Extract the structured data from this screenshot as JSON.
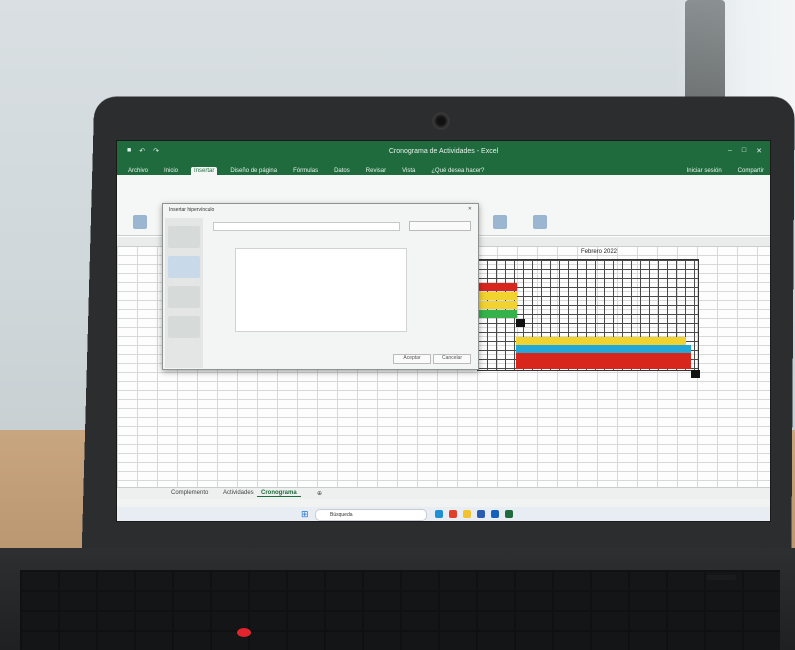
{
  "scene": "laptop-with-excel-gantt",
  "excel": {
    "title": "Cronograma de Actividades - Excel",
    "tabs": [
      "Archivo",
      "Inicio",
      "Insertar",
      "Diseño de página",
      "Fórmulas",
      "Datos",
      "Revisar",
      "Vista"
    ],
    "active_tab": "Insertar",
    "help_text": "¿Qué desea hacer?",
    "share_label": "Compartir",
    "signin_label": "Iniciar sesión",
    "month_label": "Febrero 2022",
    "sheet_tabs": [
      "Complemento",
      "Actividades",
      "Cronograma"
    ],
    "active_sheet": "Cronograma",
    "search_placeholder": "Búsqueda",
    "dialog": {
      "title": "Insertar hipervínculo",
      "ok_label": "Aceptar",
      "cancel_label": "Cancelar"
    }
  },
  "gantt_colors": {
    "red": "#d9261c",
    "yellow": "#f2d22e",
    "green": "#35b24a",
    "cyan": "#22a8d8",
    "black": "#111111"
  },
  "colors": {
    "excel_green": "#1f6b3e",
    "laptop_body": "#2b2d2f",
    "trackpoint": "#e2242f"
  }
}
